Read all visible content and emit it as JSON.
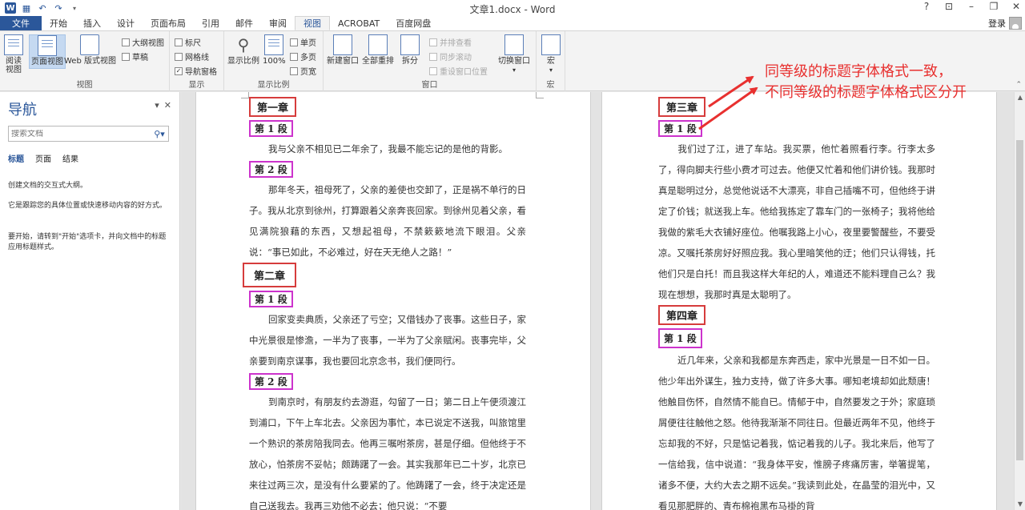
{
  "window": {
    "title": "文章1.docx - Word",
    "controls": [
      "?",
      "⊡",
      "–",
      "❐",
      "✕"
    ]
  },
  "tabs": [
    "文件",
    "开始",
    "插入",
    "设计",
    "页面布局",
    "引用",
    "邮件",
    "审阅",
    "视图",
    "ACROBAT",
    "百度网盘"
  ],
  "active_tab": "视图",
  "signin_label": "登录",
  "ribbon": {
    "views": {
      "label": "视图",
      "read_mode": "阅读视图",
      "print_layout": "页面视图",
      "web_layout": "Web 版式视图",
      "outline": "大纲视图",
      "draft": "草稿"
    },
    "show": {
      "label": "显示",
      "ruler": "标尺",
      "gridlines": "网格线",
      "nav_pane": "导航窗格"
    },
    "zoom": {
      "label": "显示比例",
      "zoom": "显示比例",
      "hundred": "100%",
      "one_page": "单页",
      "multi_page": "多页",
      "page_width": "页宽"
    },
    "window": {
      "label": "窗口",
      "new_window": "新建窗口",
      "arrange_all": "全部重排",
      "split": "拆分",
      "side_by_side": "并排查看",
      "sync_scroll": "同步滚动",
      "reset_pos": "重设窗口位置",
      "switch": "切换窗口"
    },
    "macros": {
      "label": "宏",
      "macros": "宏"
    }
  },
  "nav": {
    "title": "导航",
    "search_placeholder": "搜索文档",
    "tabs": [
      "标题",
      "页面",
      "结果"
    ],
    "msg1": "创建文档的交互式大纲。",
    "msg2": "它是跟踪您的具体位置或快速移动内容的好方式。",
    "msg3": "要开始，请转到\"开始\"选项卡，并向文档中的标题应用标题样式。"
  },
  "page1": {
    "ch1": "第一章",
    "s1": "第 1 段",
    "p1": "我与父亲不相见已二年余了，我最不能忘记的是他的背影。",
    "s2": "第 2 段",
    "p2": "那年冬天，祖母死了，父亲的差使也交卸了，正是祸不单行的日子。我从北京到徐州，打算跟着父亲奔丧回家。到徐州见着父亲，看见满院狼藉的东西，又想起祖母，不禁簌簌地流下眼泪。父亲说：“事已如此，不必难过，好在天无绝人之路！”",
    "ch2": "第二章",
    "s3": "第 1 段",
    "p3": "回家变卖典质，父亲还了亏空；又借钱办了丧事。这些日子，家中光景很是惨澹，一半为了丧事，一半为了父亲赋闲。丧事完毕，父亲要到南京谋事，我也要回北京念书，我们便同行。",
    "s4": "第 2 段",
    "p4": "到南京时，有朋友约去游逛，勾留了一日；第二日上午便须渡江到浦口，下午上车北去。父亲因为事忙，本已说定不送我，叫旅馆里一个熟识的茶房陪我同去。他再三嘱咐茶房，甚是仔细。但他终于不放心，怕茶房不妥帖；颇踌躇了一会。其实我那年已二十岁，北京已来往过两三次，是没有什么要紧的了。他踌躇了一会，终于决定还是自己送我去。我再三劝他不必去；他只说：“不要"
  },
  "page2": {
    "ch3": "第三章",
    "s1": "第 1 段",
    "p1": "我们过了江，进了车站。我买票，他忙着照看行李。行李太多了，得向脚夫行些小费才可过去。他便又忙着和他们讲价钱。我那时真是聪明过分，总觉他说话不大漂亮，非自己插嘴不可，但他终于讲定了价钱；就送我上车。他给我拣定了靠车门的一张椅子；我将他给我做的紫毛大衣铺好座位。他嘱我路上小心，夜里要警醒些，不要受凉。又嘱托茶房好好照应我。我心里暗笑他的迂；他们只认得钱，托他们只是白托！而且我这样大年纪的人，难道还不能料理自己么？我现在想想，我那时真是太聪明了。",
    "ch4": "第四章",
    "s2": "第 1 段",
    "p2": "近几年来，父亲和我都是东奔西走，家中光景是一日不如一日。他少年出外谋生，独力支持，做了许多大事。哪知老境却如此颓唐！他触目伤怀，自然情不能自已。情郁于中，自然要发之于外；家庭琐屑便往往触他之怒。他待我渐渐不同往日。但最近两年不见，他终于忘却我的不好，只是惦记着我，惦记着我的儿子。我北来后，他写了一信给我，信中说道：“我身体平安，惟膀子疼痛厉害，举箸提笔，诸多不便，大约大去之期不远矣。”我读到此处，在晶莹的泪光中，又看见那肥胖的、青布棉袍黑布马褂的背"
  },
  "annotation": {
    "line1": "同等级的标题字体格式一致，",
    "line2": "不同等级的标题字体格式区分开",
    "color": "#e8302f"
  },
  "colors": {
    "accent": "#2b579a",
    "chapter_box": "#d63c3c",
    "section_box": "#cc33cc"
  }
}
